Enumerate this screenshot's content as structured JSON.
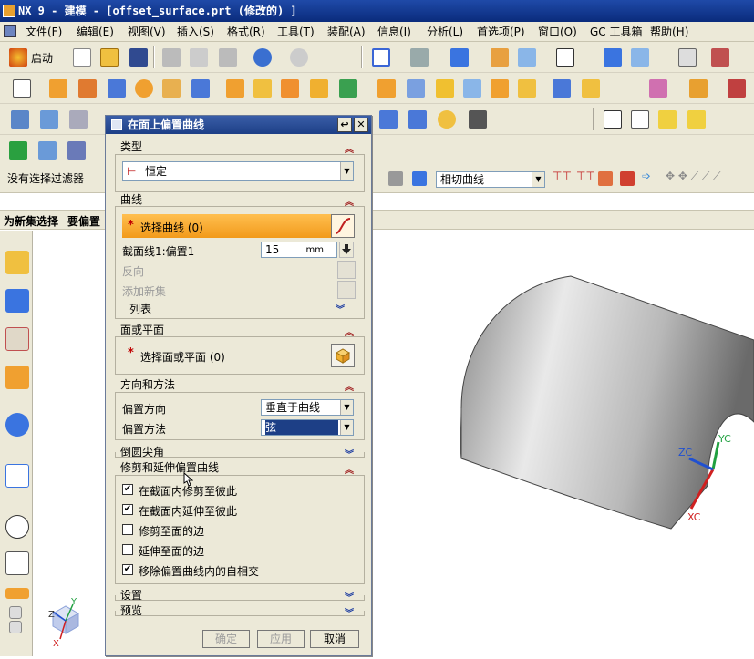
{
  "window": {
    "title": "NX 9 - 建模 - [offset_surface.prt (修改的) ]"
  },
  "menu": [
    "文件(F)",
    "编辑(E)",
    "视图(V)",
    "插入(S)",
    "格式(R)",
    "工具(T)",
    "装配(A)",
    "信息(I)",
    "分析(L)",
    "首选项(P)",
    "窗口(O)",
    "GC 工具箱",
    "帮助(H)"
  ],
  "toolbar": {
    "start_label": "启动"
  },
  "filterbar": {
    "filter_value": "没有选择过滤器",
    "curve_rule": "相切曲线"
  },
  "cuebar": {
    "left_text": "为新集选择",
    "right_text": "要偏置"
  },
  "dialog": {
    "title": "在面上偏置曲线",
    "type_group": {
      "title": "类型",
      "value": "恒定"
    },
    "curve_group": {
      "title": "曲线",
      "select_label": "选择曲线 (0)",
      "section_label": "截面线1:偏置1",
      "offset_value": "15",
      "unit": "mm",
      "reverse_label": "反向",
      "add_set_label": "添加新集",
      "list_label": "列表"
    },
    "face_group": {
      "title": "面或平面",
      "select_label": "选择面或平面 (0)"
    },
    "method_group": {
      "title": "方向和方法",
      "direction_label": "偏置方向",
      "direction_value": "垂直于曲线",
      "method_label": "偏置方法",
      "method_value": "弦"
    },
    "corner_group": {
      "title": "倒圆尖角"
    },
    "trim_group": {
      "title": "修剪和延伸偏置曲线",
      "options": [
        {
          "label": "在截面内修剪至彼此",
          "checked": true
        },
        {
          "label": "在截面内延伸至彼此",
          "checked": true
        },
        {
          "label": "修剪至面的边",
          "checked": false
        },
        {
          "label": "延伸至面的边",
          "checked": false
        },
        {
          "label": "移除偏置曲线内的自相交",
          "checked": true
        }
      ]
    },
    "settings_group": {
      "title": "设置"
    },
    "preview_group": {
      "title": "预览"
    },
    "buttons": {
      "ok": "确定",
      "apply": "应用",
      "cancel": "取消"
    }
  },
  "axes": {
    "x": "XC",
    "y": "YC",
    "z": "ZC"
  },
  "triad": {
    "x": "X",
    "y": "Y",
    "z": "Z"
  },
  "colors": {
    "accent": "#f29a1a",
    "title_bar": "#0a2b7c",
    "panel": "#ece9d8"
  }
}
